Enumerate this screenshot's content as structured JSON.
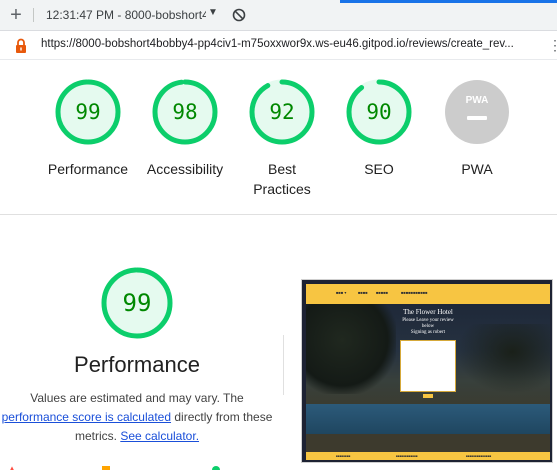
{
  "tabbar": {
    "title": "12:31:47 PM - 8000-bobshort4",
    "plus_icon": "plus-icon",
    "dropdown_icon": "triangle-down-icon",
    "block_icon": "block-icon"
  },
  "addressbar": {
    "url": "https://8000-bobshort4bobby4-pp4civ1-m75oxxwor9x.ws-eu46.gitpod.io/reviews/create_rev...",
    "lock_icon": "lock-icon"
  },
  "gauges": [
    {
      "score": "99",
      "label": "Performance",
      "level": 0.99
    },
    {
      "score": "98",
      "label": "Accessibility",
      "level": 0.98
    },
    {
      "score": "92",
      "label": "Best Practices",
      "level": 0.92
    },
    {
      "score": "90",
      "label": "SEO",
      "level": 0.9
    },
    {
      "score": "PWA",
      "label": "PWA",
      "level": 0
    }
  ],
  "performance": {
    "score": "99",
    "level": 0.99,
    "title": "Performance",
    "desc_prefix": "Values are estimated and may vary. The",
    "link_score": "performance score is calculated",
    "desc_middle": "directly from these metrics.",
    "link_calc": "See calculator."
  },
  "thumbnail": {
    "heading": "The Flower Hotel",
    "sub1": "Please Leave your review",
    "sub2": "below",
    "sub3": "Signing as robert"
  },
  "colors": {
    "pass_green": "#0cce6b",
    "pass_fill": "#e5faef",
    "pass_text": "#008800",
    "pwa_gray": "#cccccc",
    "link_blue": "#1a4fd9",
    "site_yellow": "#f7c542"
  }
}
